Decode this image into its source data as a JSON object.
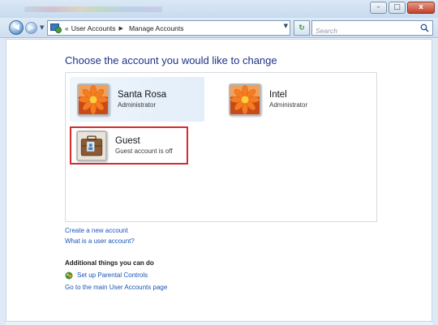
{
  "window": {
    "controls": {
      "minimize_glyph": "–",
      "maximize_glyph": "□",
      "close_glyph": "x"
    }
  },
  "navigation": {
    "back_glyph": "◀",
    "forward_glyph": "▶",
    "history_glyph": "▼",
    "breadcrumb": {
      "overflow": "«",
      "items": [
        "User Accounts",
        "Manage Accounts"
      ],
      "separator": "▶"
    },
    "address_dropdown_glyph": "▼",
    "refresh_glyph": "↻",
    "search_placeholder": "Search"
  },
  "main": {
    "heading": "Choose the account you would like to change",
    "accounts": [
      {
        "name": "Santa Rosa",
        "detail": "Administrator",
        "picture": "flower-icon",
        "highlighted": true,
        "selected": false
      },
      {
        "name": "Intel",
        "detail": "Administrator",
        "picture": "flower-icon",
        "highlighted": false,
        "selected": false
      },
      {
        "name": "Guest",
        "detail": "Guest account is off",
        "picture": "guest-briefcase-icon",
        "highlighted": false,
        "selected": true
      }
    ],
    "links": [
      "Create a new account",
      "What is a user account?"
    ],
    "extras": {
      "title": "Additional things you can do",
      "parental_controls": "Set up Parental Controls",
      "main_page": "Go to the main User Accounts page"
    }
  },
  "colors": {
    "heading": "#1e3287",
    "link": "#1a55b8",
    "selection_outline": "#d42c2c",
    "hover_background": "#e8f1fb"
  }
}
